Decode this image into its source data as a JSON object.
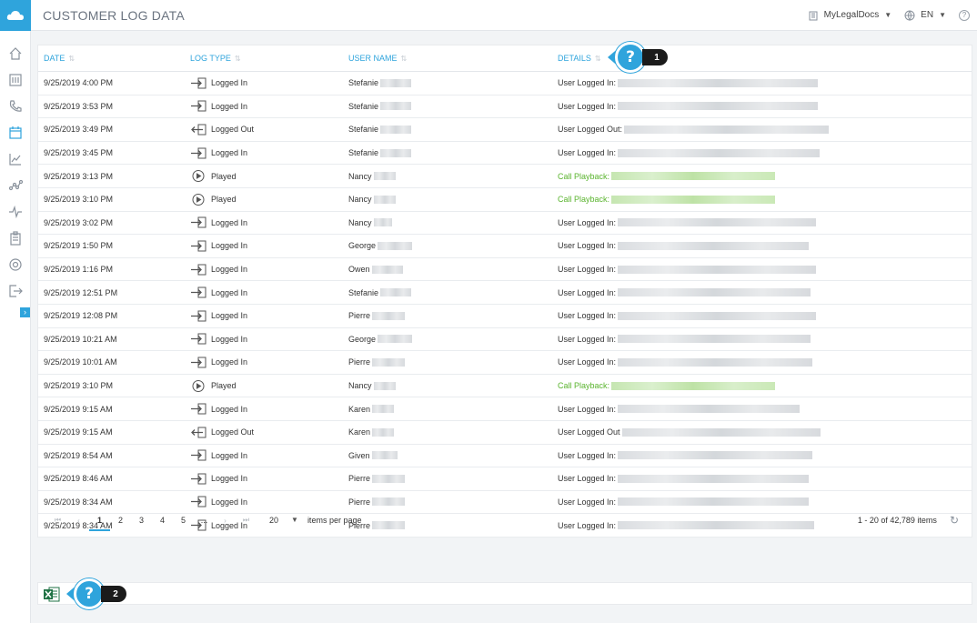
{
  "header": {
    "title": "CUSTOMER LOG DATA",
    "account": "MyLegalDocs",
    "language": "EN"
  },
  "sidebar": {
    "items": [
      {
        "icon": "home-icon"
      },
      {
        "icon": "dashboard-icon"
      },
      {
        "icon": "phone-icon"
      },
      {
        "icon": "calendar-icon",
        "active": true
      },
      {
        "icon": "chart-icon"
      },
      {
        "icon": "analytics-icon"
      },
      {
        "icon": "pulse-icon"
      },
      {
        "icon": "clipboard-icon"
      },
      {
        "icon": "settings-icon"
      },
      {
        "icon": "logout-icon"
      }
    ],
    "expand_label": "›"
  },
  "table": {
    "columns": [
      "DATE",
      "LOG TYPE",
      "USER NAME",
      "DETAILS"
    ],
    "rows": [
      {
        "date": "9/25/2019 4:00 PM",
        "type": "Logged In",
        "icon": "login-icon",
        "user": "Stefanie",
        "details": "User Logged In:",
        "green": false
      },
      {
        "date": "9/25/2019 3:53 PM",
        "type": "Logged In",
        "icon": "login-icon",
        "user": "Stefanie",
        "details": "User Logged In:",
        "green": false
      },
      {
        "date": "9/25/2019 3:49 PM",
        "type": "Logged Out",
        "icon": "logout-arrow-icon",
        "user": "Stefanie",
        "details": "User Logged Out:",
        "green": false
      },
      {
        "date": "9/25/2019 3:45 PM",
        "type": "Logged In",
        "icon": "login-icon",
        "user": "Stefanie",
        "details": "User Logged In:",
        "green": false
      },
      {
        "date": "9/25/2019 3:13 PM",
        "type": "Played",
        "icon": "play-icon",
        "user": "Nancy",
        "details": "Call Playback:",
        "green": true
      },
      {
        "date": "9/25/2019 3:10 PM",
        "type": "Played",
        "icon": "play-icon",
        "user": "Nancy",
        "details": "Call Playback:",
        "green": true
      },
      {
        "date": "9/25/2019 3:02 PM",
        "type": "Logged In",
        "icon": "login-icon",
        "user": "Nancy",
        "details": "User Logged In:",
        "green": false
      },
      {
        "date": "9/25/2019 1:50 PM",
        "type": "Logged In",
        "icon": "login-icon",
        "user": "George",
        "details": "User Logged In:",
        "green": false
      },
      {
        "date": "9/25/2019 1:16 PM",
        "type": "Logged In",
        "icon": "login-icon",
        "user": "Owen",
        "details": "User Logged In:",
        "green": false
      },
      {
        "date": "9/25/2019 12:51 PM",
        "type": "Logged In",
        "icon": "login-icon",
        "user": "Stefanie",
        "details": "User Logged In:",
        "green": false
      },
      {
        "date": "9/25/2019 12:08 PM",
        "type": "Logged In",
        "icon": "login-icon",
        "user": "Pierre",
        "details": "User Logged In:",
        "green": false
      },
      {
        "date": "9/25/2019 10:21 AM",
        "type": "Logged In",
        "icon": "login-icon",
        "user": "George",
        "details": "User Logged In:",
        "green": false
      },
      {
        "date": "9/25/2019 10:01 AM",
        "type": "Logged In",
        "icon": "login-icon",
        "user": "Pierre",
        "details": "User Logged In:",
        "green": false
      },
      {
        "date": "9/25/2019 3:10 PM",
        "type": "Played",
        "icon": "play-icon",
        "user": "Nancy",
        "details": "Call Playback:",
        "green": true
      },
      {
        "date": "9/25/2019 9:15 AM",
        "type": "Logged In",
        "icon": "login-icon",
        "user": "Karen",
        "details": "User Logged In:",
        "green": false
      },
      {
        "date": "9/25/2019 9:15 AM",
        "type": "Logged Out",
        "icon": "logout-arrow-icon",
        "user": "Karen",
        "details": "User Logged Out",
        "green": false
      },
      {
        "date": "9/25/2019 8:54 AM",
        "type": "Logged In",
        "icon": "login-icon",
        "user": "Given",
        "details": "User Logged In:",
        "green": false
      },
      {
        "date": "9/25/2019 8:46 AM",
        "type": "Logged In",
        "icon": "login-icon",
        "user": "Pierre",
        "details": "User Logged In:",
        "green": false
      },
      {
        "date": "9/25/2019 8:34 AM",
        "type": "Logged In",
        "icon": "login-icon",
        "user": "Pierre",
        "details": "User Logged In:",
        "green": false
      },
      {
        "date": "9/25/2019 8:34 AM",
        "type": "Logged In",
        "icon": "login-icon",
        "user": "Pierre",
        "details": "User Logged In:",
        "green": false
      }
    ]
  },
  "pager": {
    "first": "⏮",
    "prev": "‹",
    "pages": [
      "1",
      "2",
      "3",
      "4",
      "5",
      "..."
    ],
    "current": "1",
    "next": "›",
    "last": "⏭",
    "page_size": "20",
    "page_size_label": "items per page",
    "summary": "1 - 20 of 42,789 items"
  },
  "callouts": [
    {
      "symbol": "?",
      "number": "1"
    },
    {
      "symbol": "?",
      "number": "2"
    }
  ],
  "colors": {
    "accent": "#2fa4dc",
    "green": "#5ab42e"
  }
}
